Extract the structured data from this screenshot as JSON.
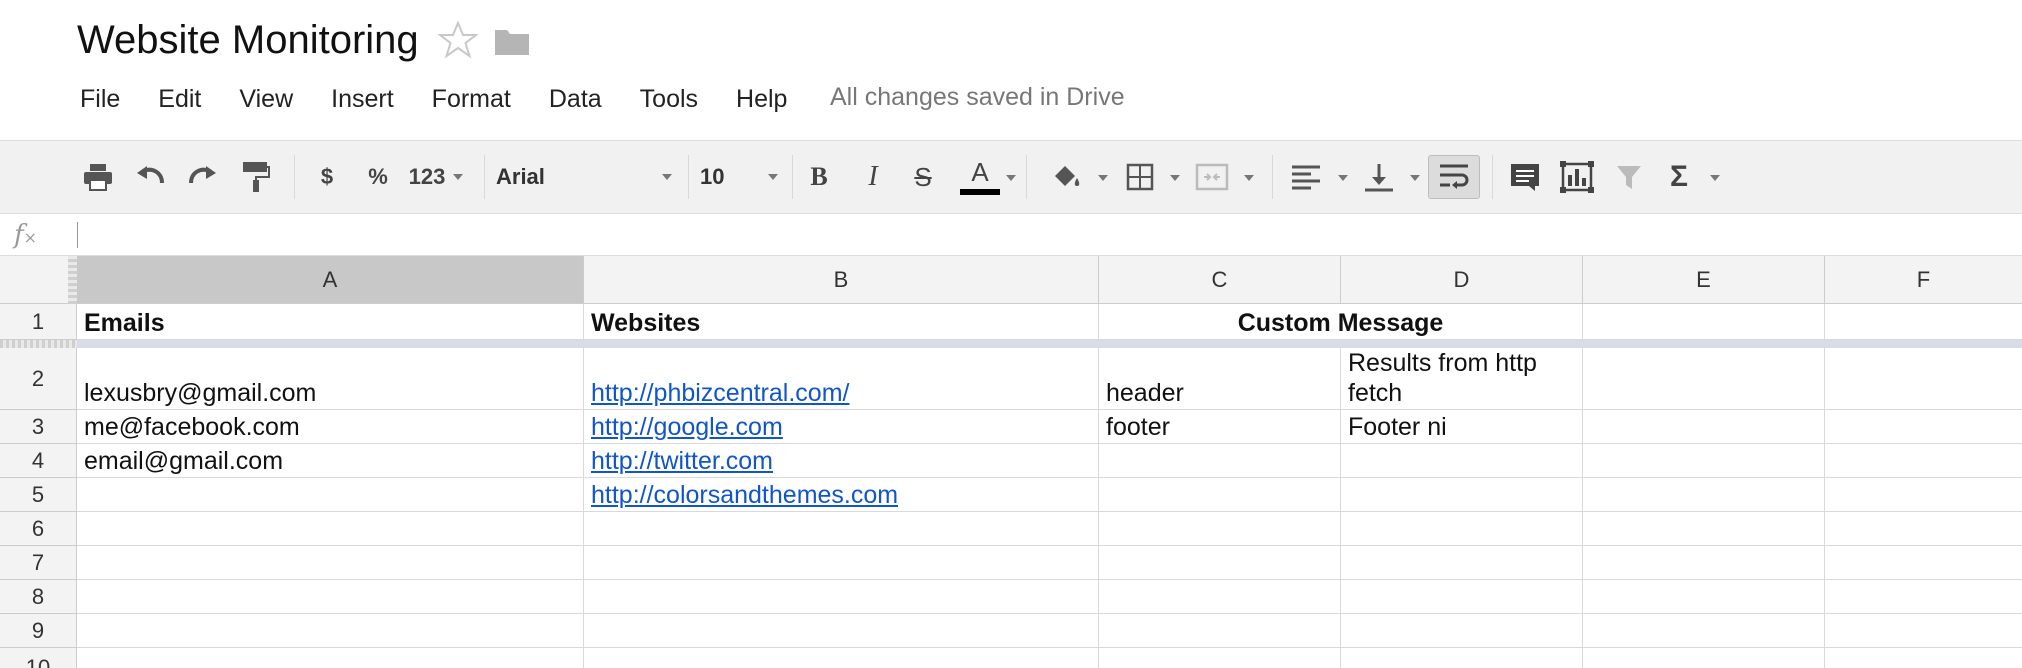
{
  "document": {
    "title": "Website Monitoring",
    "status": "All changes saved in Drive"
  },
  "menu": [
    "File",
    "Edit",
    "View",
    "Insert",
    "Format",
    "Data",
    "Tools",
    "Help"
  ],
  "toolbar": {
    "currency_label": "$",
    "percent_label": "%",
    "number_format_label": "123",
    "font_family": "Arial",
    "font_size": "10",
    "text_color": "#000000"
  },
  "formula_bar": {
    "icon_text": "fx",
    "value": ""
  },
  "columns": [
    "A",
    "B",
    "C",
    "D",
    "E",
    "F"
  ],
  "rows": [
    "1",
    "2",
    "3",
    "4",
    "5",
    "6",
    "7",
    "8",
    "9",
    "10"
  ],
  "cells": {
    "A1": "Emails",
    "B1": "Websites",
    "C1": "Custom Message",
    "A2": "lexusbry@gmail.com",
    "B2": "http://phbizcentral.com/",
    "C2": "header",
    "D2": "Results from http fetch",
    "A3": "me@facebook.com",
    "B3": "http://google.com",
    "C3": "footer",
    "D3": "Footer ni",
    "A4": "email@gmail.com",
    "B4": "http://twitter.com",
    "B5": "http://colorsandthemes.com"
  },
  "colors": {
    "link": "#1155cc",
    "selected_header": "#c8c8c8",
    "header_bg": "#f3f3f3"
  }
}
